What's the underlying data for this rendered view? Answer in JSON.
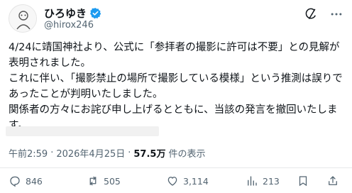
{
  "author": {
    "display_name": "ひろゆき",
    "handle": "@hirox246"
  },
  "tweet": {
    "text": "4/24に靖国神社より、公式に「参拝者の撮影に許可は不要」との見解が表明されました。\nこれに伴い、「撮影禁止の場所で撮影している模様」という推測は誤りであったことが判明いたしました。\n関係者の方々にお詫び申し上げるとともに、当該の発言を撤回いたします。"
  },
  "meta": {
    "time": "午前2:59",
    "separator": "·",
    "date": "2026年4月25日",
    "views_count": "57.5万",
    "views_label": "件の表示"
  },
  "actions": {
    "replies": "846",
    "retweets": "505",
    "likes": "3,114",
    "bookmarks": "213"
  },
  "colors": {
    "verified": "#1d9bf0",
    "secondary_text": "#536471",
    "primary_text": "#0f1419"
  }
}
